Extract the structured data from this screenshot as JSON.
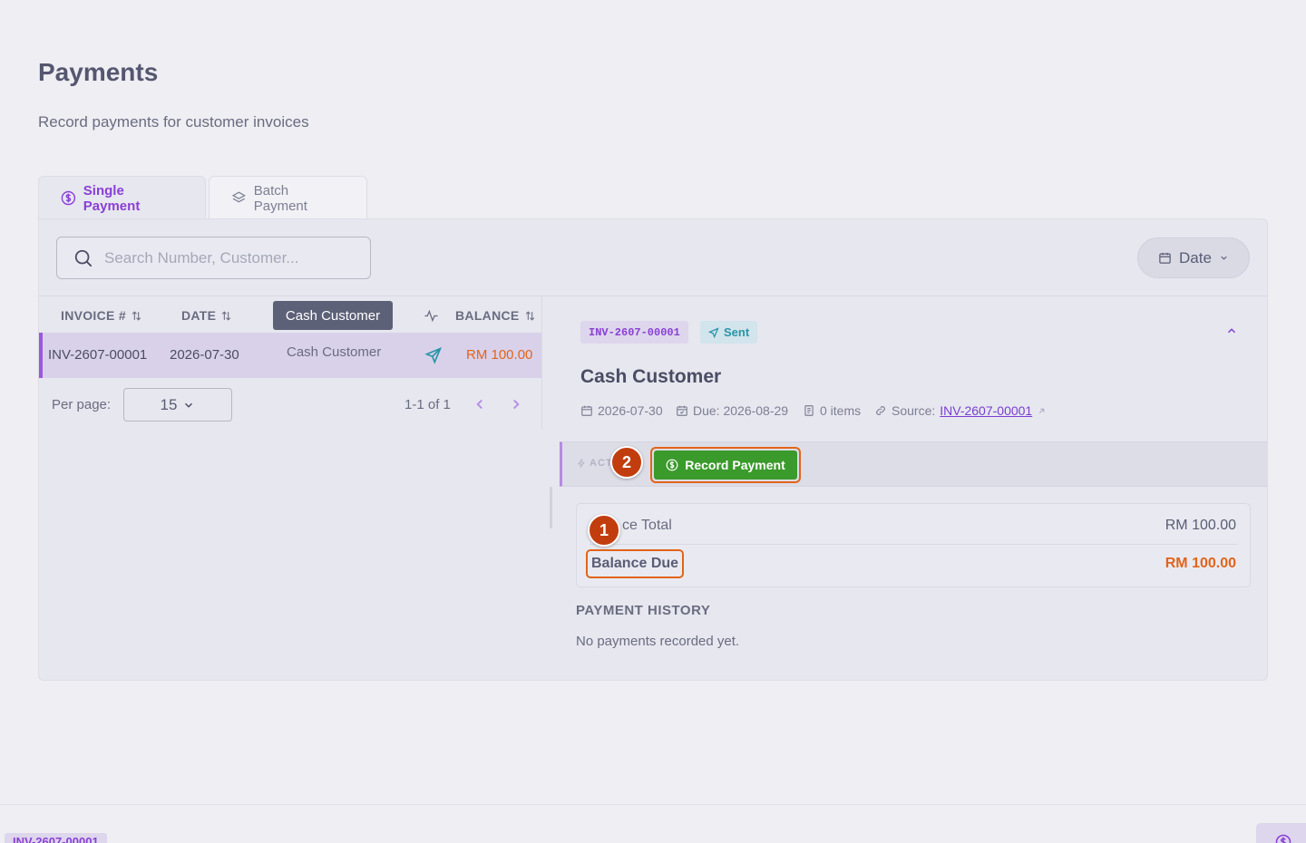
{
  "page": {
    "title": "Payments",
    "subtitle": "Record payments for customer invoices"
  },
  "tabs": [
    {
      "label": "Single Payment",
      "icon": "dollar-circle-icon",
      "active": true
    },
    {
      "label": "Batch Payment",
      "icon": "layers-icon",
      "active": false
    }
  ],
  "search": {
    "placeholder": "Search Number, Customer..."
  },
  "filter": {
    "date_label": "Date"
  },
  "table": {
    "columns": [
      "INVOICE #",
      "DATE",
      "",
      "BALANCE"
    ],
    "tooltip": "Cash Customer",
    "rows": [
      {
        "invoice": "INV-2607-00001",
        "date": "2026-07-30",
        "customer": "Cash Customer",
        "balance": "RM 100.00",
        "status_icon": "send-icon"
      }
    ],
    "per_page_label": "Per page:",
    "per_page_value": "15",
    "range": "1-1 of 1"
  },
  "detail": {
    "invoice_badge": "INV-2607-00001",
    "status": "Sent",
    "customer": "Cash Customer",
    "date": "2026-07-30",
    "due": "Due: 2026-08-29",
    "items": "0 items",
    "source_label": "Source:",
    "source_link": "INV-2607-00001",
    "actions_label": "ACT",
    "record_button": "Record Payment",
    "invoice_total_label": "ce Total",
    "invoice_total": "RM 100.00",
    "balance_due_label": "Balance Due",
    "balance_due": "RM 100.00",
    "history_title": "PAYMENT HISTORY",
    "history_empty": "No payments recorded yet."
  },
  "markers": [
    "1",
    "2"
  ],
  "footer": {
    "badge": "INV-2607-00001"
  },
  "colors": {
    "accent": "#8a3fd6",
    "success": "#3a9a2b",
    "warning": "#e2641b",
    "marker": "#c23d0e"
  }
}
